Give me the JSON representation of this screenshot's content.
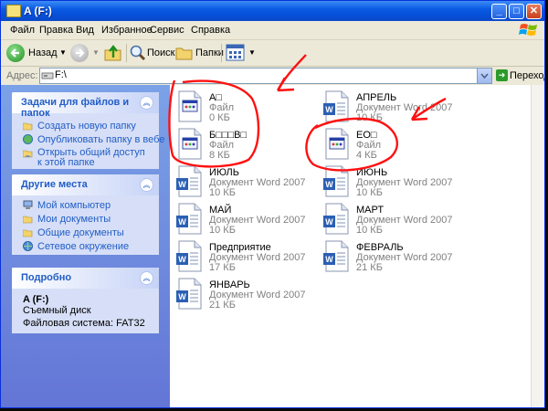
{
  "window": {
    "title": "A (F:)"
  },
  "titlebar_buttons": {
    "minimize": "_",
    "maximize": "□",
    "close": "✕"
  },
  "menu": [
    "Файл",
    "Правка",
    "Вид",
    "Избранное",
    "Сервис",
    "Справка"
  ],
  "toolbar": {
    "back": "Назад",
    "search": "Поиск",
    "folders": "Папки"
  },
  "address": {
    "label": "Адрес:",
    "value": "F:\\",
    "go": "Переход"
  },
  "tasks_panel": {
    "title": "Задачи для файлов и папок",
    "items": [
      "Создать новую папку",
      "Опубликовать папку в вебе",
      "Открыть общий доступ к этой папке"
    ]
  },
  "places_panel": {
    "title": "Другие места",
    "items": [
      "Мой компьютер",
      "Мои документы",
      "Общие документы",
      "Сетевое окружение"
    ]
  },
  "details_panel": {
    "title": "Подробно",
    "name": "A (F:)",
    "kind": "Съемный диск",
    "fs": "Файловая система: FAT32"
  },
  "files": [
    {
      "name": "А□",
      "type": "Файл",
      "size": "0 КБ",
      "icon": "generic-file-icon"
    },
    {
      "name": "АПРЕЛЬ",
      "type": "Документ Word 2007",
      "size": "10 КБ",
      "icon": "word-document-icon"
    },
    {
      "name": "Б□□□В□",
      "type": "Файл",
      "size": "8 КБ",
      "icon": "generic-file-icon"
    },
    {
      "name": "ЕО□",
      "type": "Файл",
      "size": "4 КБ",
      "icon": "generic-file-icon"
    },
    {
      "name": "ИЮЛЬ",
      "type": "Документ Word 2007",
      "size": "10 КБ",
      "icon": "word-document-icon"
    },
    {
      "name": "ИЮНЬ",
      "type": "Документ Word 2007",
      "size": "10 КБ",
      "icon": "word-document-icon"
    },
    {
      "name": "МАЙ",
      "type": "Документ Word 2007",
      "size": "10 КБ",
      "icon": "word-document-icon"
    },
    {
      "name": "МАРТ",
      "type": "Документ Word 2007",
      "size": "10 КБ",
      "icon": "word-document-icon"
    },
    {
      "name": "Предприятие",
      "type": "Документ Word 2007",
      "size": "17 КБ",
      "icon": "word-document-icon"
    },
    {
      "name": "ФЕВРАЛЬ",
      "type": "Документ Word 2007",
      "size": "21 КБ",
      "icon": "word-document-icon"
    },
    {
      "name": "ЯНВАРЬ",
      "type": "Документ Word 2007",
      "size": "21 КБ",
      "icon": "word-document-icon"
    }
  ],
  "colors": {
    "titlebar": "#0b5be3",
    "annotation": "#ff0000",
    "link": "#215dc6",
    "sidepane": "#6375d6"
  }
}
